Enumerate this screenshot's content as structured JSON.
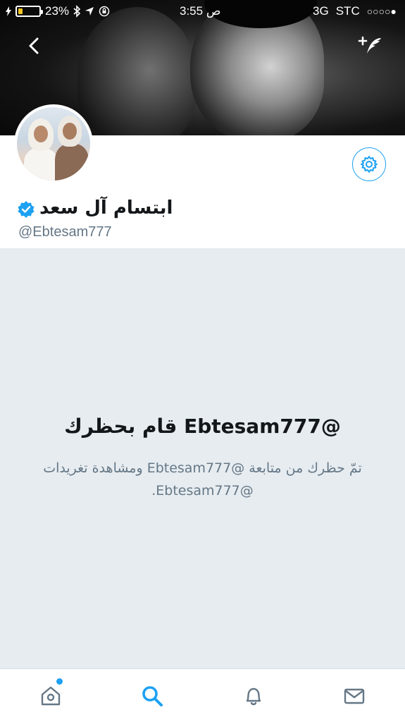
{
  "status_bar": {
    "battery_percent": "23%",
    "battery_level": 0.23,
    "time": "3:55 ص",
    "network": "3G",
    "carrier": "STC",
    "signal": "○○○○●"
  },
  "profile": {
    "display_name": "ابتسام آل سعد",
    "handle": "@Ebtesam777",
    "verified": true
  },
  "blocked": {
    "title": "@Ebtesam777 قام بحظرك",
    "description": "تمّ حظرك من متابعة @Ebtesam777 ومشاهدة تغريدات @Ebtesam777."
  },
  "icons": {
    "back": "chevron-left-icon",
    "compose": "compose-feather-icon",
    "settings": "gear-icon",
    "verified": "verified-badge-icon",
    "home": "home-icon",
    "search": "search-icon",
    "notifications": "bell-icon",
    "messages": "envelope-icon"
  },
  "colors": {
    "accent": "#1da1f2",
    "background_blocked": "#e6ecf0",
    "text_primary": "#14171a",
    "text_secondary": "#657786",
    "battery": "#f5c623"
  }
}
